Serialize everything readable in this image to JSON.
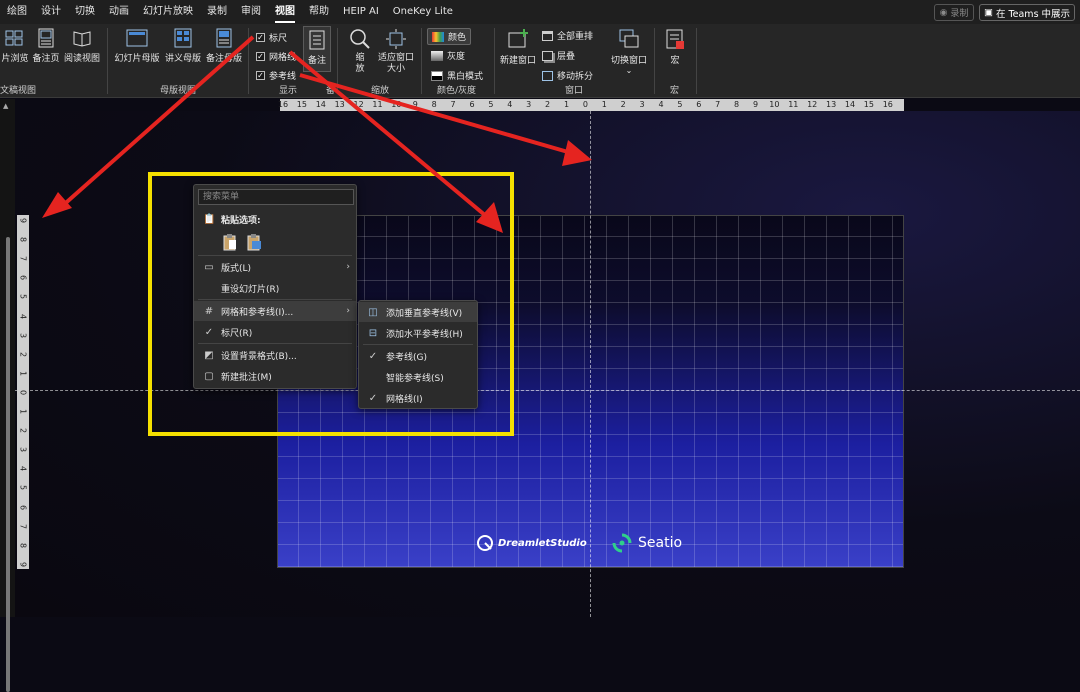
{
  "menubar": {
    "tabs": [
      "绘图",
      "设计",
      "切换",
      "动画",
      "幻灯片放映",
      "录制",
      "审阅",
      "视图",
      "帮助",
      "HEIP AI",
      "OneKey Lite"
    ],
    "active": "视图",
    "record": "录制",
    "teams": "在 Teams 中展示"
  },
  "ribbon": {
    "views": {
      "slide_sorter": "片浏览",
      "notes_page": "备注页",
      "reading_view": "阅读视图",
      "group": "文稿视图"
    },
    "master": {
      "slide_master": "幻灯片母版",
      "handout_master": "讲义母版",
      "notes_master": "备注母版",
      "group": "母版视图"
    },
    "show": {
      "ruler": "标尺",
      "gridlines": "网格线",
      "guides": "参考线",
      "notes": "备注",
      "group": "显示",
      "group_cut": "备"
    },
    "zoom": {
      "zoom": "缩放",
      "fit": "适应窗口大小",
      "group": "缩放"
    },
    "color": {
      "color": "颜色",
      "grayscale": "灰度",
      "bw": "黑白模式",
      "group": "颜色/灰度"
    },
    "window": {
      "new_window": "新建窗口",
      "arrange_all": "全部重排",
      "cascade": "层叠",
      "move_split": "移动拆分",
      "switch": "切换窗口",
      "group": "窗口"
    },
    "macro": {
      "macro": "宏",
      "group": "宏"
    }
  },
  "ruler": {
    "h_ticks": [
      "16",
      "15",
      "14",
      "13",
      "12",
      "11",
      "10",
      "9",
      "8",
      "7",
      "6",
      "5",
      "4",
      "3",
      "2",
      "1",
      "0",
      "1",
      "2",
      "3",
      "4",
      "5",
      "6",
      "7",
      "8",
      "9",
      "10",
      "11",
      "12",
      "13",
      "14",
      "15",
      "16"
    ],
    "v_ticks": [
      "9",
      "8",
      "7",
      "6",
      "5",
      "4",
      "3",
      "2",
      "1",
      "0",
      "1",
      "2",
      "3",
      "4",
      "5",
      "6",
      "7",
      "8",
      "9"
    ]
  },
  "context_menu": {
    "search_placeholder": "搜索菜单",
    "paste_options": "粘贴选项:",
    "layout": "版式(L)",
    "reset_slide": "重设幻灯片(R)",
    "grid_guides": "网格和参考线(I)...",
    "ruler": "标尺(R)",
    "format_background": "设置背景格式(B)...",
    "new_comment": "新建批注(M)"
  },
  "submenu": {
    "add_vertical": "添加垂直参考线(V)",
    "add_horizontal": "添加水平参考线(H)",
    "guides": "参考线(G)",
    "smart_guides": "智能参考线(S)",
    "gridlines": "网格线(I)"
  },
  "slide": {
    "logo1": "DreamletStudio",
    "logo2": "Seatio"
  },
  "colors": {
    "highlight": "#f5e000",
    "arrow": "#e52420"
  }
}
